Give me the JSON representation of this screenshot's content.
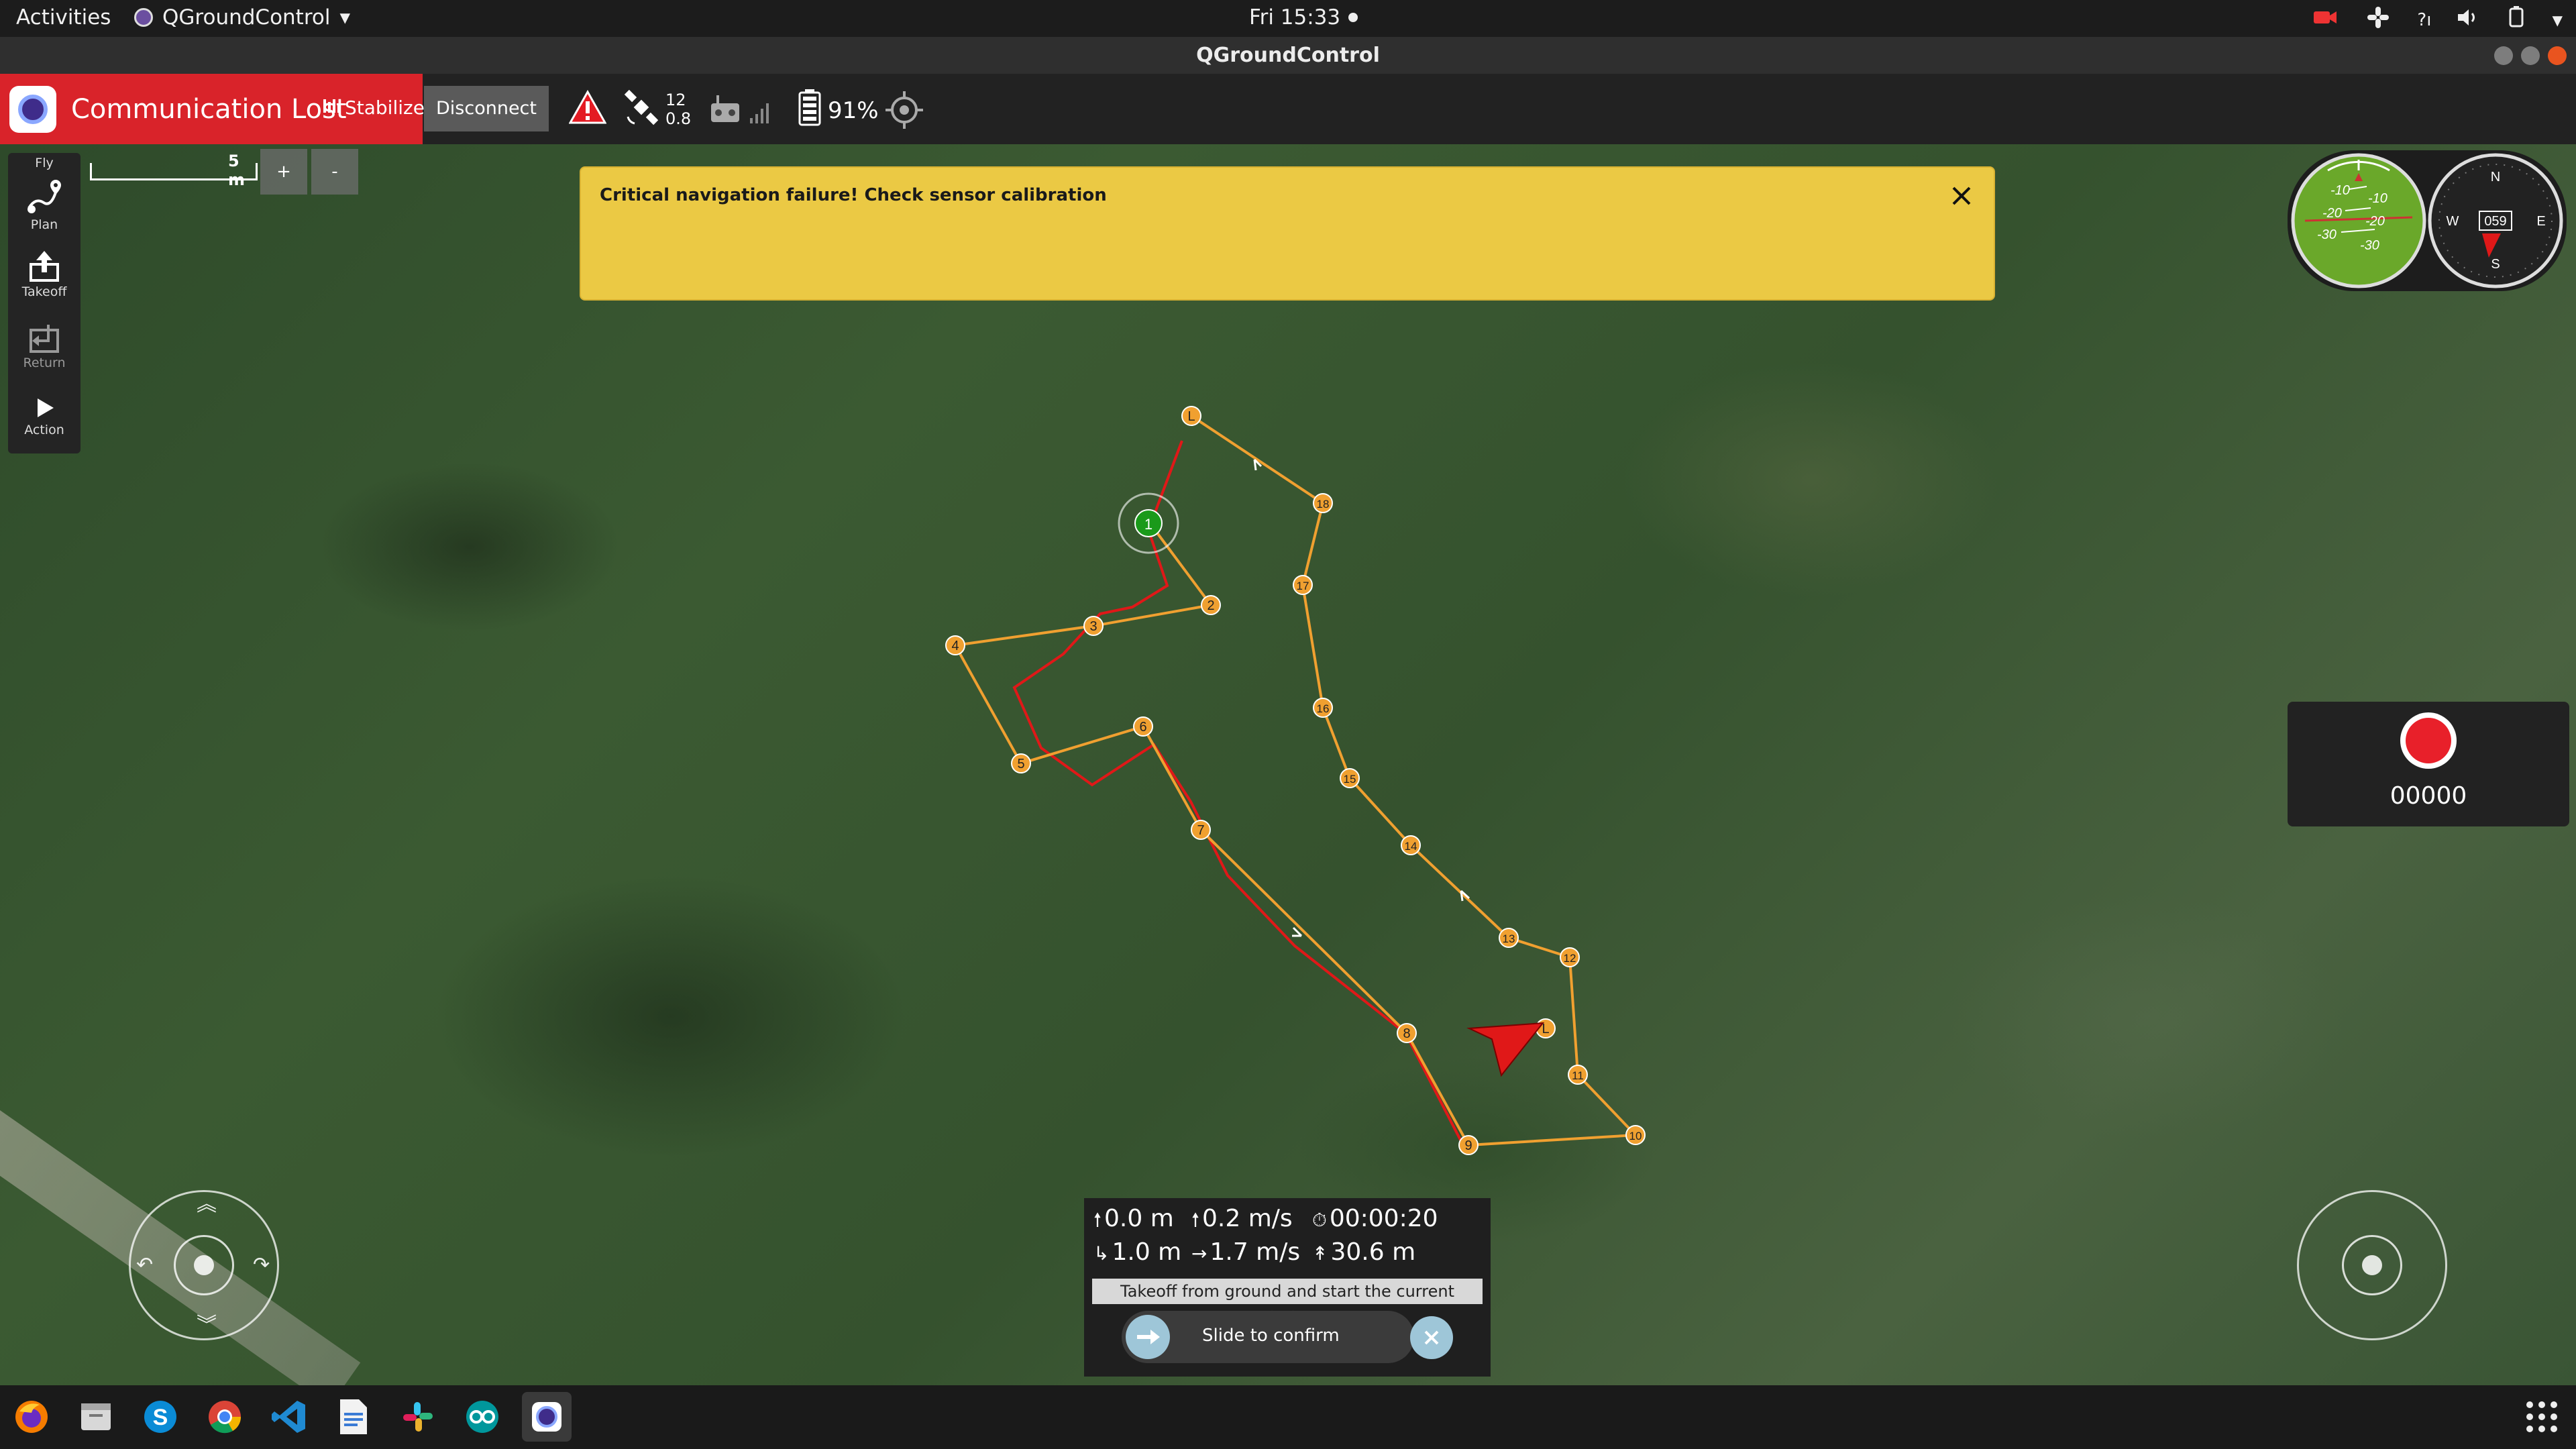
{
  "system_bar": {
    "activities": "Activities",
    "app_name": "QGroundControl",
    "clock": "Fri 15:33",
    "tray_icons": [
      "camera-recording-icon",
      "slack-icon",
      "help-icon",
      "volume-icon",
      "power-icon",
      "menu-chevron-icon"
    ]
  },
  "window": {
    "title": "QGroundControl"
  },
  "toolbar": {
    "status": "Communication Lost",
    "flight_mode": "Stabilized",
    "disconnect_label": "Disconnect",
    "gps_count": "12",
    "gps_hdop": "0.8",
    "battery": "91%"
  },
  "toolstrip": {
    "fly": "Fly",
    "plan": "Plan",
    "takeoff": "Takeoff",
    "return": "Return",
    "action": "Action"
  },
  "map": {
    "scale_label": "5 m",
    "zoom_in": "+",
    "zoom_out": "-",
    "waypoints": [
      "L",
      "1",
      "2",
      "3",
      "4",
      "5",
      "6",
      "7",
      "8",
      "9",
      "10",
      "11",
      "12",
      "13",
      "14",
      "15",
      "16",
      "17",
      "18",
      "L"
    ]
  },
  "alert": {
    "message": "Critical navigation failure! Check sensor calibration"
  },
  "instruments": {
    "attitude_labels": [
      "-10",
      "-10",
      "-20",
      "-20",
      "-30",
      "-30"
    ],
    "compass_heading": "059",
    "compass_n": "N",
    "compass_e": "E",
    "compass_s": "S",
    "compass_w": "W"
  },
  "camera": {
    "record_time": "00000"
  },
  "telemetry": {
    "altitude": "0.0 m",
    "vertical_speed": "0.2 m/s",
    "flight_time": "00:00:20",
    "distance_home": "1.0 m",
    "horizontal_speed": "1.7 m/s",
    "distance_wp": "30.6 m"
  },
  "confirm": {
    "prompt": "Takeoff from ground and start the current mission.",
    "slider_label": "Slide to confirm"
  },
  "dock": {
    "apps": [
      "firefox-icon",
      "files-icon",
      "skype-icon",
      "chrome-icon",
      "vscode-icon",
      "text-editor-icon",
      "slack-icon",
      "arduino-icon",
      "qgroundcontrol-icon"
    ]
  },
  "colors": {
    "alert_bg": "#ebc944",
    "status_red": "#d9232a",
    "mission_orange": "#f0a030",
    "flight_path_red": "#e01818"
  }
}
